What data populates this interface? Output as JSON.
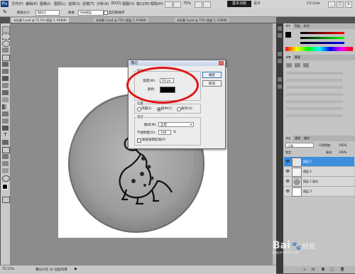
{
  "menubar": {
    "logo": "Ps",
    "items": [
      "文件(F)",
      "编辑(E)",
      "图像(I)",
      "图层(L)",
      "选择(S)",
      "滤镜(T)",
      "分析(A)",
      "3D(D)",
      "视图(V)",
      "窗口(W)",
      "帮助(H)"
    ],
    "zoom": "75%",
    "workspace": "基本功能",
    "design": "设计",
    "cslive": "CS Live"
  },
  "options": {
    "width_label": "取样大小",
    "width_value": "取样点",
    "sample_label": "样本",
    "sample_value": "所有图层",
    "ring_label": "显示取样环"
  },
  "tabs": [
    {
      "label": "未标题-1.psd @ 75.1% (图层 5, RGB/8)"
    },
    {
      "label": "未标题-2.psd @ 75% (图层 5, RGB/8)"
    },
    {
      "label": "未标题-3.psd @ 75% (图层 5, RGB/8)"
    }
  ],
  "status": {
    "zoom": "75.15%",
    "doc": "曝光只在 32 位起作用"
  },
  "dialog": {
    "title": "描边",
    "stroke_group": "描边",
    "width_label": "宽度(W):",
    "width_value": "10 px",
    "color_label": "颜色:",
    "color_value": "#000000",
    "position_group": "位置",
    "positions": [
      "内部(I)",
      "居中(C)",
      "居外(U)"
    ],
    "selected_position": "居中(C)",
    "blend_group": "混合",
    "mode_label": "模式(M):",
    "mode_value": "正常",
    "opacity_label": "不透明度(O):",
    "opacity_value": "100",
    "opacity_unit": "%",
    "preserve_label": "保留透明区域(P)",
    "ok": "确定",
    "cancel": "取消"
  },
  "panels": {
    "tabs_top": [
      "颜色",
      "色板",
      "样式"
    ],
    "adjust_tabs": [
      "调整",
      "蒙版"
    ],
    "layers_tabs": [
      "图层",
      "通道",
      "路径"
    ],
    "blend_mode": "正常",
    "opacity_label": "不透明度:",
    "opacity_value": "100%",
    "lock_label": "锁定:",
    "fill_label": "填充:",
    "fill_value": "100%",
    "layers": [
      {
        "name": "图层 5",
        "selected": true
      },
      {
        "name": "图层 4",
        "selected": false
      },
      {
        "name": "图层 1 副本",
        "selected": false
      },
      {
        "name": "图层 3",
        "selected": false
      }
    ]
  },
  "watermark": {
    "brand": "Bai",
    "suffix": "经验",
    "site": "jingyan.baidu.com"
  },
  "colors": {
    "accent": "#3d8ede",
    "annotation": "#e01616",
    "canvas_bg": "#8c8c8c"
  }
}
